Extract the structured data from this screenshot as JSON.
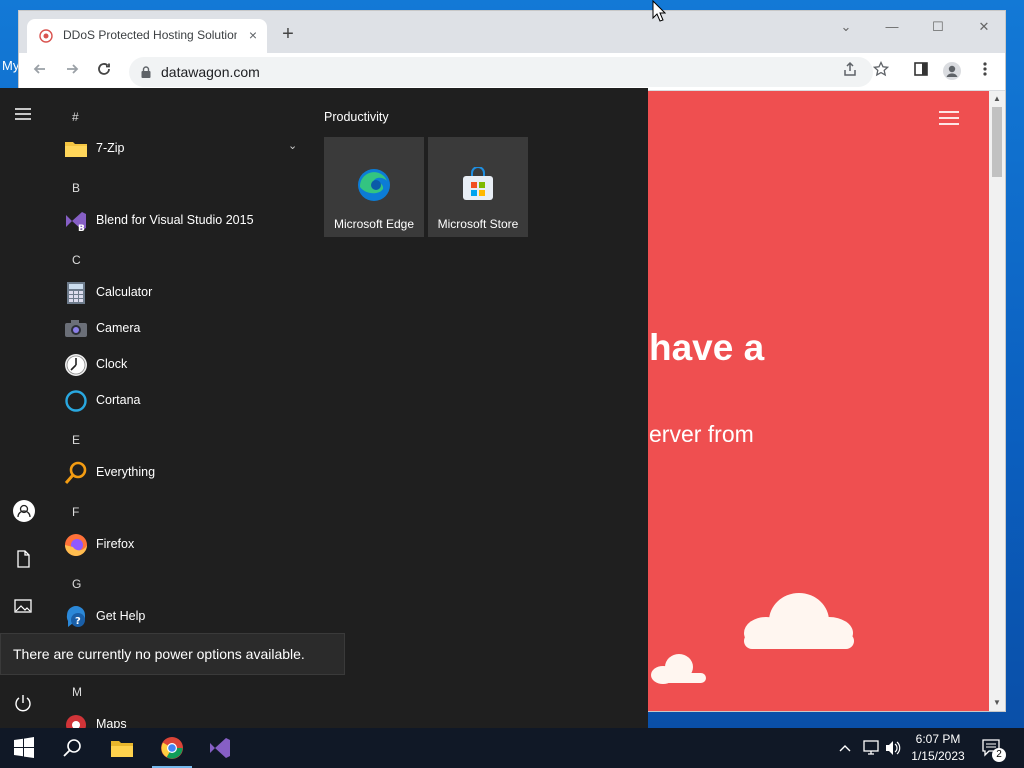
{
  "desktop": {
    "label_fragment": "My"
  },
  "browser": {
    "tab_title": "DDoS Protected Hosting Solution",
    "tab_close": "×",
    "new_tab": "+",
    "url": "datawagon.com",
    "window_controls": {
      "tab_search": "⌄",
      "minimize": "—",
      "maximize": "☐",
      "close": "✕"
    }
  },
  "page": {
    "hero_title_fragment": "have a",
    "hero_sub_fragment": "erver from",
    "accent": "#ef4f50"
  },
  "start_menu": {
    "sections": [
      {
        "letter": "#",
        "apps": [
          {
            "name": "7-Zip",
            "icon": "folder-icon",
            "expandable": true
          }
        ]
      },
      {
        "letter": "B",
        "apps": [
          {
            "name": "Blend for Visual Studio 2015",
            "icon": "blend-icon"
          }
        ]
      },
      {
        "letter": "C",
        "apps": [
          {
            "name": "Calculator",
            "icon": "calculator-icon"
          },
          {
            "name": "Camera",
            "icon": "camera-icon"
          },
          {
            "name": "Clock",
            "icon": "clock-icon"
          },
          {
            "name": "Cortana",
            "icon": "cortana-icon"
          }
        ]
      },
      {
        "letter": "E",
        "apps": [
          {
            "name": "Everything",
            "icon": "everything-icon"
          }
        ]
      },
      {
        "letter": "F",
        "apps": [
          {
            "name": "Firefox",
            "icon": "firefox-icon"
          }
        ]
      },
      {
        "letter": "G",
        "apps": [
          {
            "name": "Get Help",
            "icon": "get-help-icon"
          }
        ]
      },
      {
        "letter": "M",
        "apps": [
          {
            "name": "Maps",
            "icon": "maps-icon"
          }
        ]
      }
    ],
    "group_title": "Productivity",
    "tiles": [
      {
        "label": "Microsoft Edge",
        "icon": "edge-icon"
      },
      {
        "label": "Microsoft Store",
        "icon": "store-icon"
      }
    ],
    "power_tooltip": "There are currently no power options available."
  },
  "taskbar": {
    "time": "6:07 PM",
    "date": "1/15/2023",
    "notification_count": "2"
  }
}
